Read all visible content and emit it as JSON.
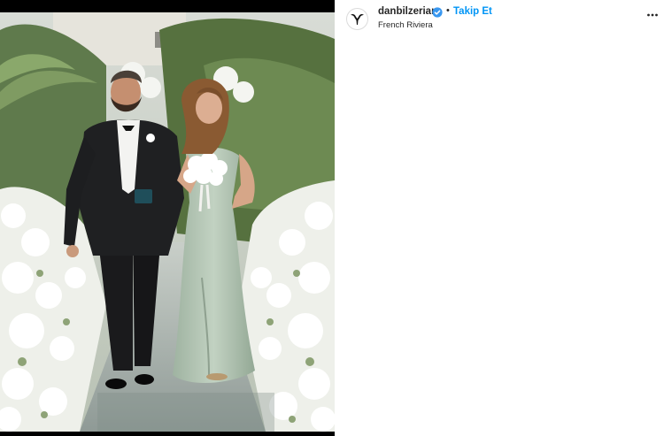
{
  "post": {
    "username": "danbilzerian",
    "separator": "•",
    "follow_label": "Takip Et",
    "location": "French Riviera",
    "verified_icon": "verified-badge-icon",
    "more_icon": "more-options-icon",
    "avatar_icon": "ram-skull-logo-icon",
    "photo_subject": "wedding-aisle-photo"
  },
  "colors": {
    "accent": "#0095f6",
    "verified": "#3897f0",
    "text": "#262626"
  }
}
